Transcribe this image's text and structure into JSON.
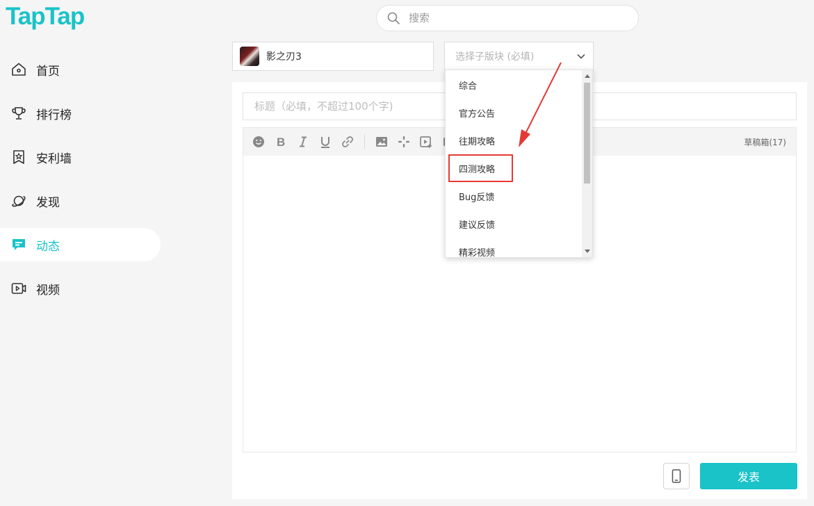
{
  "colors": {
    "brand": "#19c3c8",
    "arrow": "#e53935"
  },
  "logo": {
    "text": "TapTap"
  },
  "search": {
    "placeholder": "搜索",
    "icon": "search-icon"
  },
  "nav": {
    "items": [
      {
        "label": "首页",
        "icon": "home-icon",
        "active": false
      },
      {
        "label": "排行榜",
        "icon": "trophy-icon",
        "active": false
      },
      {
        "label": "安利墙",
        "icon": "bookmark-star-icon",
        "active": false
      },
      {
        "label": "发现",
        "icon": "planet-icon",
        "active": false
      },
      {
        "label": "动态",
        "icon": "chat-bubble-icon",
        "active": true
      },
      {
        "label": "视频",
        "icon": "video-icon",
        "active": false
      }
    ]
  },
  "composer": {
    "game": {
      "name": "影之刃3"
    },
    "subforum": {
      "placeholder": "选择子版块 (必填)"
    },
    "title": {
      "placeholder": "标题（必填，不超过100个字)"
    },
    "toolbar": {
      "tools": [
        "emoji-icon",
        "bold-icon",
        "italic-icon",
        "underline-icon",
        "link-icon",
        "image-icon",
        "game-icon",
        "video-icon",
        "more-icon"
      ],
      "draft_label": "草稿箱(17)"
    },
    "publish_label": "发表"
  },
  "dropdown": {
    "options": [
      "综合",
      "官方公告",
      "往期攻略",
      "四测攻略",
      "Bug反馈",
      "建议反馈",
      "精彩视频"
    ],
    "highlighted": "四测攻略"
  }
}
